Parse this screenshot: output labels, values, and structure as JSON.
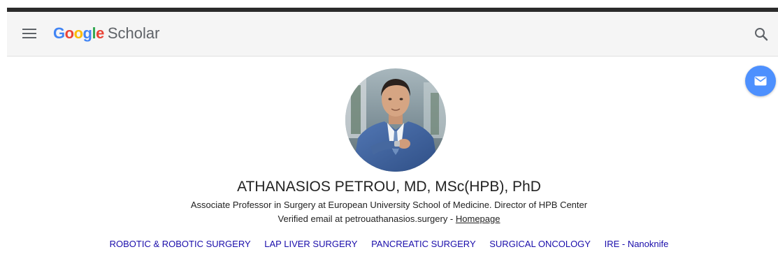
{
  "header": {
    "logo": {
      "letters": [
        "G",
        "o",
        "o",
        "g",
        "l",
        "e"
      ],
      "product": "Scholar"
    }
  },
  "profile": {
    "name": "ATHANASIOS PETROU, MD, MSc(HPB), PhD",
    "affiliation": "Associate Professor in Surgery at European University School of Medicine. Director of HPB Center",
    "verified_email_text": "Verified email at petrouathanasios.surgery - ",
    "homepage_label": "Homepage",
    "interests": [
      "ROBOTIC & ROBOTIC SURGERY",
      "LAP LIVER SURGERY",
      "PANCREATIC SURGERY",
      "SURGICAL ONCOLOGY",
      "IRE - Nanoknife"
    ]
  },
  "icons": {
    "menu": "hamburger-menu-icon",
    "search": "search-icon",
    "follow": "envelope-icon"
  },
  "colors": {
    "google_blue": "#4285f4",
    "google_red": "#ea4335",
    "google_yellow": "#fbbc05",
    "google_green": "#34a853",
    "fab_blue": "#4d90fe",
    "link_blue": "#1a0dab"
  }
}
